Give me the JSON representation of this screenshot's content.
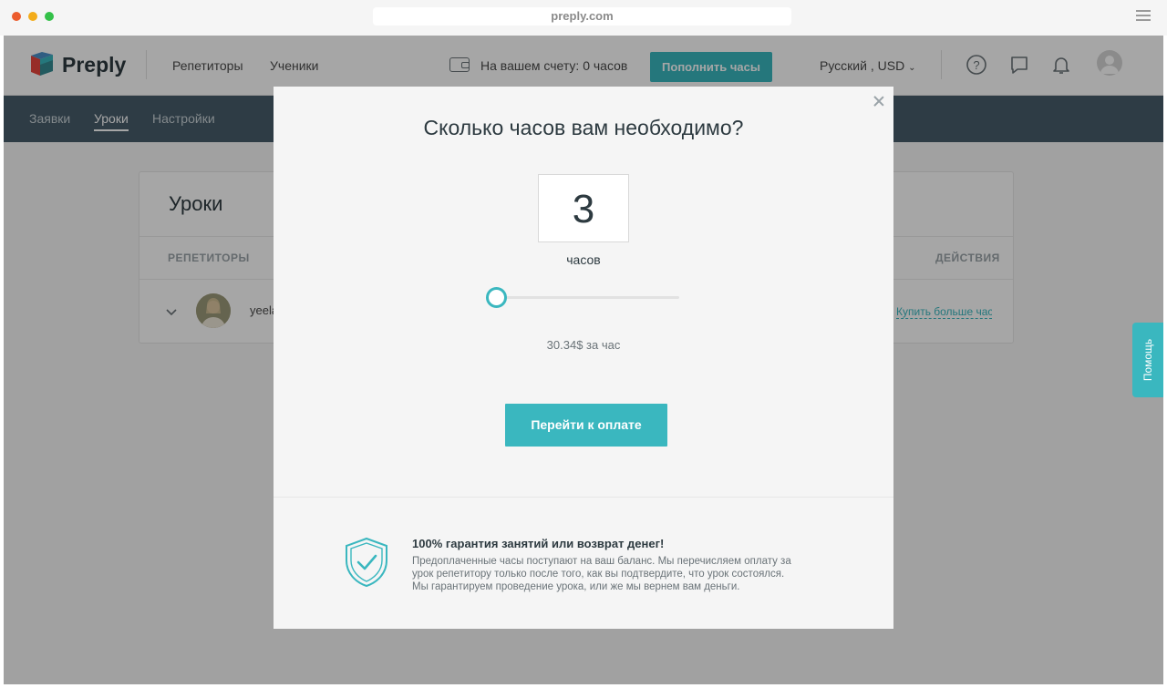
{
  "browser": {
    "url": "preply.com"
  },
  "header": {
    "logo_text": "Preply",
    "nav": [
      "Репетиторы",
      "Ученики"
    ],
    "balance_text": "На вашем счету: 0 часов",
    "topup_label": "Пополнить часы",
    "language": "Русский , USD"
  },
  "subnav": {
    "tabs": [
      "Заявки",
      "Уроки",
      "Настройки"
    ],
    "active_tab": "Уроки"
  },
  "lessons": {
    "title": "Уроки",
    "col_tutors": "РЕПЕТИТОРЫ",
    "col_actions": "ДЕЙСТВИЯ",
    "row_name": "yeela",
    "row_action": "Купить больше часов"
  },
  "help_tab": "Помощь",
  "modal": {
    "title": "Сколько часов вам необходимо?",
    "hours": "3",
    "hours_unit": "часов",
    "slider_fraction": 0.0,
    "price": "30.34$ за час",
    "pay_button": "Перейти к оплате",
    "guarantee_title": "100% гарантия занятий или возврат денег!",
    "guarantee_text_1": "Предоплаченные часы поступают на ваш баланс. Мы перечисляем оплату за",
    "guarantee_text_2": "урок репетитору только после того, как вы подтвердите, что урок состоялся.",
    "guarantee_text_3": "Мы гарантируем проведение урока, или же мы вернем вам деньги."
  },
  "colors": {
    "accent": "#3ab7bf",
    "subnav_bg": "#485d6a",
    "text_dark": "#2d3a40"
  }
}
